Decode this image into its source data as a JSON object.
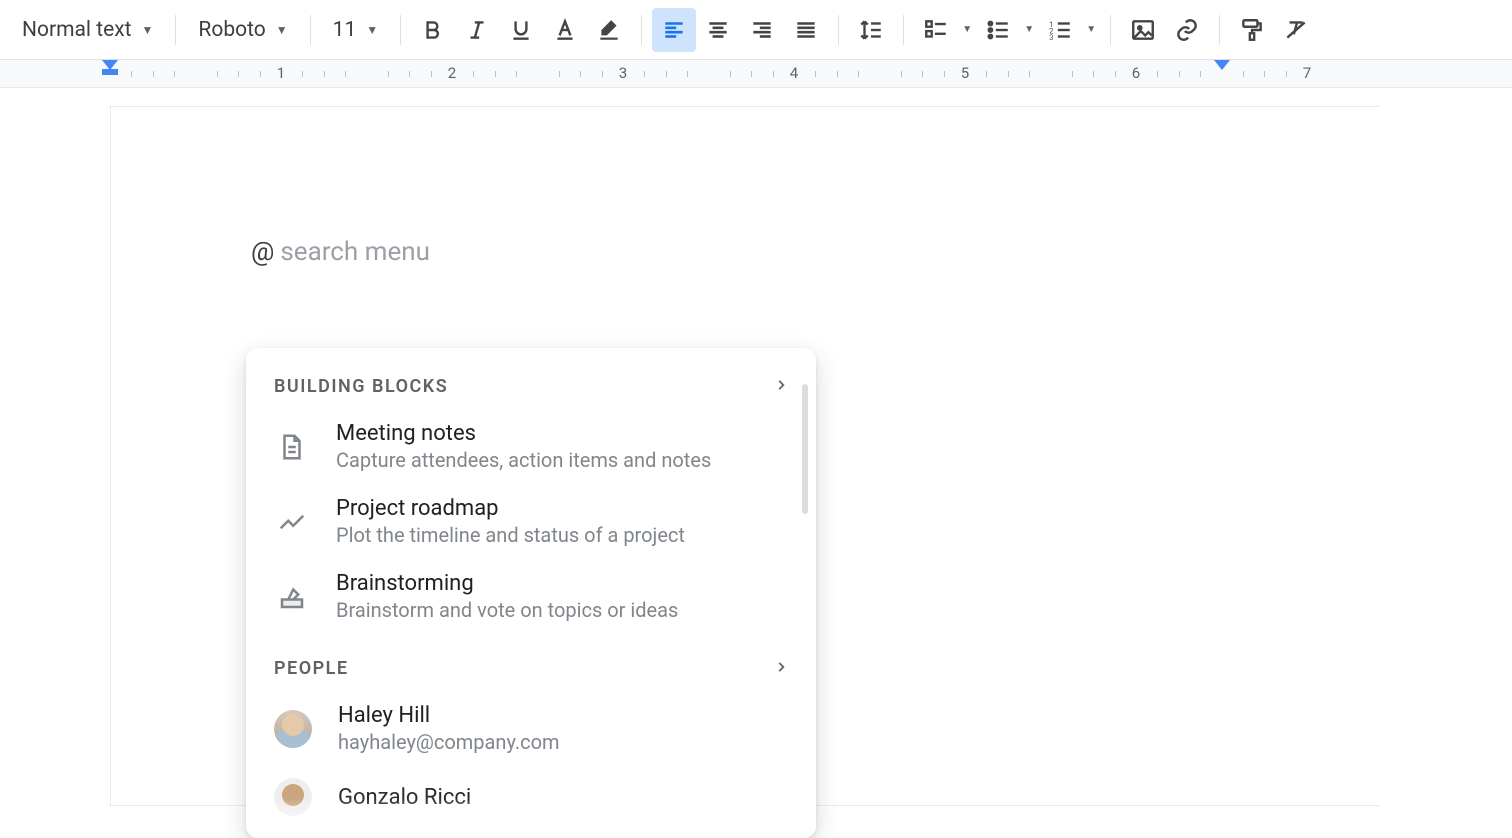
{
  "toolbar": {
    "style_select": "Normal text",
    "font_select": "Roboto",
    "font_size": "11"
  },
  "ruler": {
    "numbers": [
      "1",
      "2",
      "3",
      "4",
      "5",
      "6",
      "7"
    ]
  },
  "doc": {
    "at_symbol": "@",
    "placeholder": "search menu"
  },
  "popup": {
    "sections": {
      "blocks": {
        "header": "BUILDING BLOCKS",
        "items": [
          {
            "title": "Meeting notes",
            "sub": "Capture attendees, action items and notes",
            "icon": "doc"
          },
          {
            "title": "Project roadmap",
            "sub": "Plot the timeline and status of a project",
            "icon": "chart"
          },
          {
            "title": "Brainstorming",
            "sub": "Brainstorm and vote on topics or ideas",
            "icon": "vote"
          }
        ]
      },
      "people": {
        "header": "PEOPLE",
        "items": [
          {
            "title": "Haley Hill",
            "sub": "hayhaley@company.com"
          },
          {
            "title": "Gonzalo Ricci",
            "sub": ""
          }
        ]
      }
    }
  }
}
